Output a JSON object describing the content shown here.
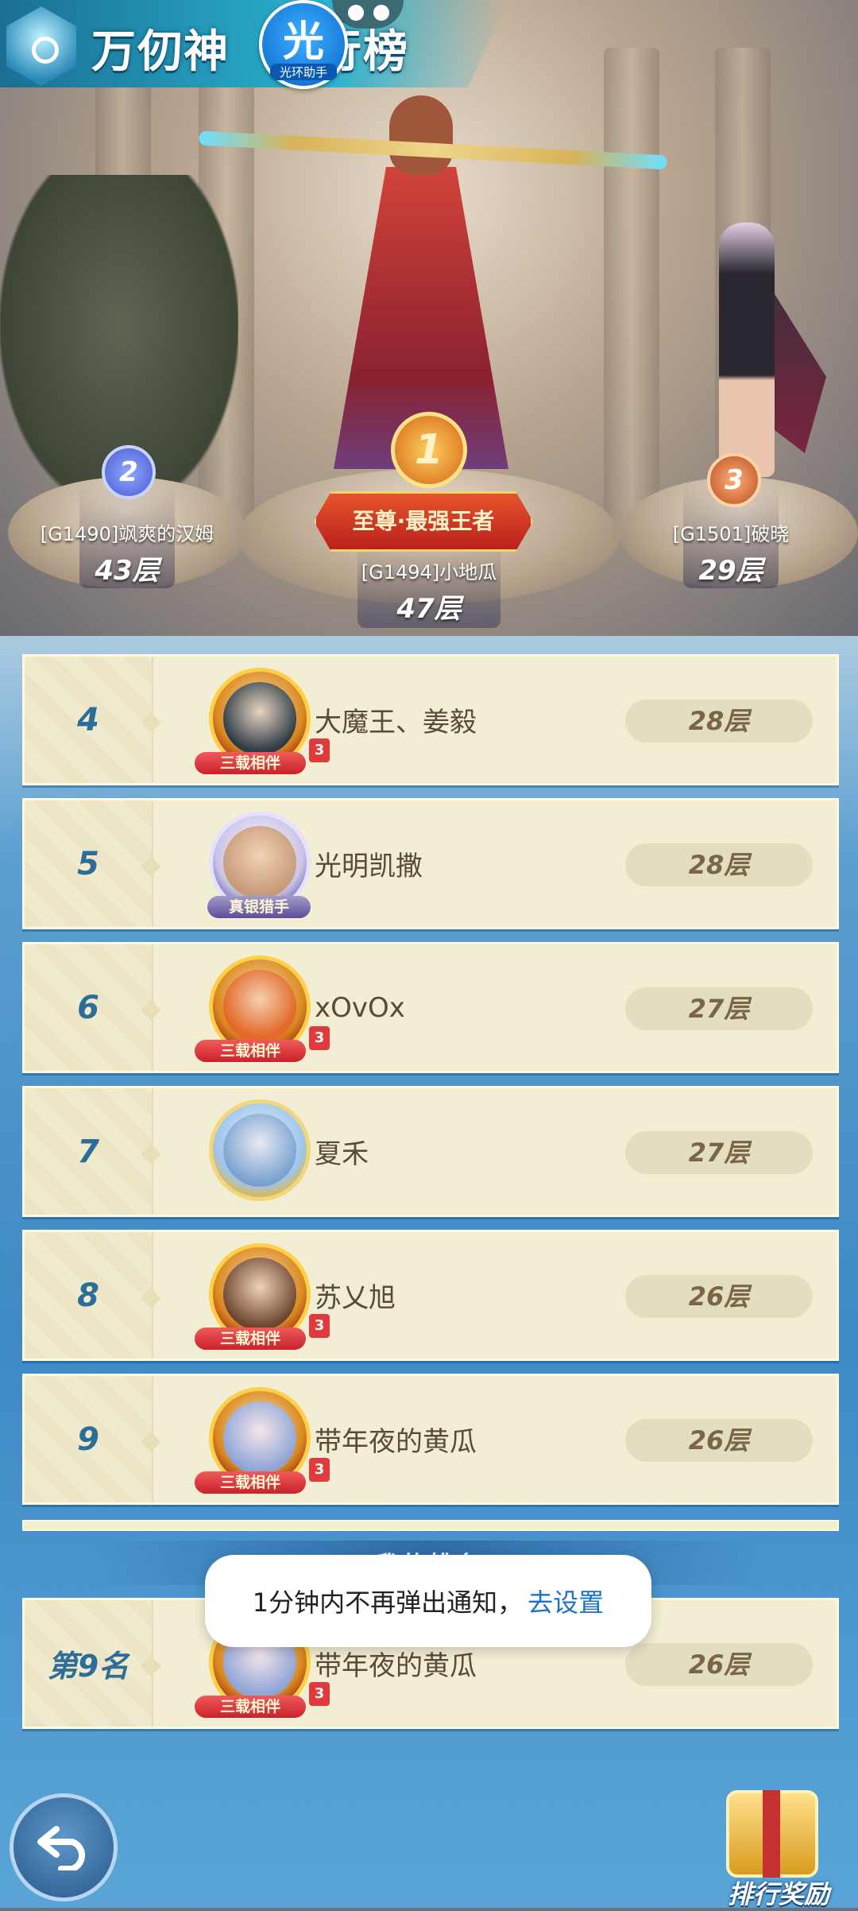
{
  "header": {
    "title": "万仞神庙排行榜",
    "title_left": "万仞神",
    "title_right": "行榜",
    "overlay_badge_char": "光",
    "overlay_badge_label": "光环助手"
  },
  "podium": [
    {
      "rank": "2",
      "name": "[G1490]飒爽的汉姆",
      "floor": "43层"
    },
    {
      "rank": "1",
      "name": "[G1494]小地瓜",
      "floor": "47层",
      "banner": "至尊·最强王者"
    },
    {
      "rank": "3",
      "name": "[G1501]破晓",
      "floor": "29层"
    }
  ],
  "list": [
    {
      "rank": "4",
      "name": "大魔王、姜毅",
      "floor": "28层",
      "avatar_tag": "三载相伴"
    },
    {
      "rank": "5",
      "name": "光明凯撒",
      "floor": "28层",
      "avatar_tag": "真银猎手"
    },
    {
      "rank": "6",
      "name": "xOvOx",
      "floor": "27层",
      "avatar_tag": "三载相伴"
    },
    {
      "rank": "7",
      "name": "夏禾",
      "floor": "27层",
      "avatar_tag": ""
    },
    {
      "rank": "8",
      "name": "苏乂旭",
      "floor": "26层",
      "avatar_tag": "三载相伴"
    },
    {
      "rank": "9",
      "name": "带年夜的黄瓜",
      "floor": "26层",
      "avatar_tag": "三载相伴"
    }
  ],
  "my_rank": {
    "section_title": "我的排名",
    "rank_label": "第9名",
    "name": "带年夜的黄瓜",
    "floor": "26层",
    "avatar_tag": "三载相伴"
  },
  "toast": {
    "message": "1分钟内不再弹出通知，",
    "link": "去设置"
  },
  "buttons": {
    "reward_label": "排行奖励",
    "back": "back"
  },
  "colors": {
    "rank_number": "#2d6e99",
    "row_bg": "#f2eed4",
    "floor_text": "#7a6548",
    "toast_link": "#1a73c9"
  }
}
